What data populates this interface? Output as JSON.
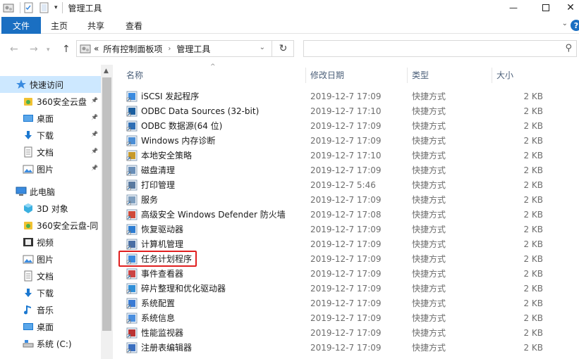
{
  "window": {
    "title": "管理工具"
  },
  "ribbon": {
    "tab_file": "文件",
    "tab_home": "主页",
    "tab_share": "共享",
    "tab_view": "查看"
  },
  "address": {
    "overflow": "«",
    "crumbs": [
      "所有控制面板项",
      "管理工具"
    ]
  },
  "nav": {
    "items": [
      {
        "label": "快速访问",
        "icon": "star-icon"
      },
      {
        "label": "360安全云盘",
        "icon": "cloud-drive-icon"
      },
      {
        "label": "桌面",
        "icon": "desktop-icon"
      },
      {
        "label": "下载",
        "icon": "download-icon"
      },
      {
        "label": "文档",
        "icon": "document-icon"
      },
      {
        "label": "图片",
        "icon": "picture-icon"
      },
      {
        "label": "此电脑",
        "icon": "computer-icon"
      },
      {
        "label": "3D 对象",
        "icon": "3d-objects-icon"
      },
      {
        "label": "360安全云盘-同",
        "icon": "cloud-drive-icon"
      },
      {
        "label": "视频",
        "icon": "video-icon"
      },
      {
        "label": "图片",
        "icon": "picture-icon"
      },
      {
        "label": "文档",
        "icon": "document-icon"
      },
      {
        "label": "下载",
        "icon": "download-icon"
      },
      {
        "label": "音乐",
        "icon": "music-icon"
      },
      {
        "label": "桌面",
        "icon": "desktop-icon"
      },
      {
        "label": "系统 (C:)",
        "icon": "drive-icon"
      }
    ]
  },
  "columns": {
    "name": "名称",
    "date": "修改日期",
    "type": "类型",
    "size": "大小"
  },
  "files": [
    {
      "name": "iSCSI 发起程序",
      "date": "2019-12-7 17:09",
      "type": "快捷方式",
      "size": "2 KB"
    },
    {
      "name": "ODBC Data Sources (32-bit)",
      "date": "2019-12-7 17:10",
      "type": "快捷方式",
      "size": "2 KB"
    },
    {
      "name": "ODBC 数据源(64 位)",
      "date": "2019-12-7 17:09",
      "type": "快捷方式",
      "size": "2 KB"
    },
    {
      "name": "Windows 内存诊断",
      "date": "2019-12-7 17:09",
      "type": "快捷方式",
      "size": "2 KB"
    },
    {
      "name": "本地安全策略",
      "date": "2019-12-7 17:10",
      "type": "快捷方式",
      "size": "2 KB"
    },
    {
      "name": "磁盘清理",
      "date": "2019-12-7 17:09",
      "type": "快捷方式",
      "size": "2 KB"
    },
    {
      "name": "打印管理",
      "date": "2019-12-7 5:46",
      "type": "快捷方式",
      "size": "2 KB"
    },
    {
      "name": "服务",
      "date": "2019-12-7 17:09",
      "type": "快捷方式",
      "size": "2 KB"
    },
    {
      "name": "高级安全 Windows Defender 防火墙",
      "date": "2019-12-7 17:08",
      "type": "快捷方式",
      "size": "2 KB"
    },
    {
      "name": "恢复驱动器",
      "date": "2019-12-7 17:09",
      "type": "快捷方式",
      "size": "2 KB"
    },
    {
      "name": "计算机管理",
      "date": "2019-12-7 17:09",
      "type": "快捷方式",
      "size": "2 KB"
    },
    {
      "name": "任务计划程序",
      "date": "2019-12-7 17:09",
      "type": "快捷方式",
      "size": "2 KB"
    },
    {
      "name": "事件查看器",
      "date": "2019-12-7 17:09",
      "type": "快捷方式",
      "size": "2 KB"
    },
    {
      "name": "碎片整理和优化驱动器",
      "date": "2019-12-7 17:09",
      "type": "快捷方式",
      "size": "2 KB"
    },
    {
      "name": "系统配置",
      "date": "2019-12-7 17:09",
      "type": "快捷方式",
      "size": "2 KB"
    },
    {
      "name": "系统信息",
      "date": "2019-12-7 17:09",
      "type": "快捷方式",
      "size": "2 KB"
    },
    {
      "name": "性能监视器",
      "date": "2019-12-7 17:09",
      "type": "快捷方式",
      "size": "2 KB"
    },
    {
      "name": "注册表编辑器",
      "date": "2019-12-7 17:09",
      "type": "快捷方式",
      "size": "2 KB"
    }
  ],
  "highlighted_item": "任务计划程序",
  "colors": {
    "accent": "#1a6fc2",
    "selection": "#cde8ff",
    "highlight_border": "#e02020"
  }
}
